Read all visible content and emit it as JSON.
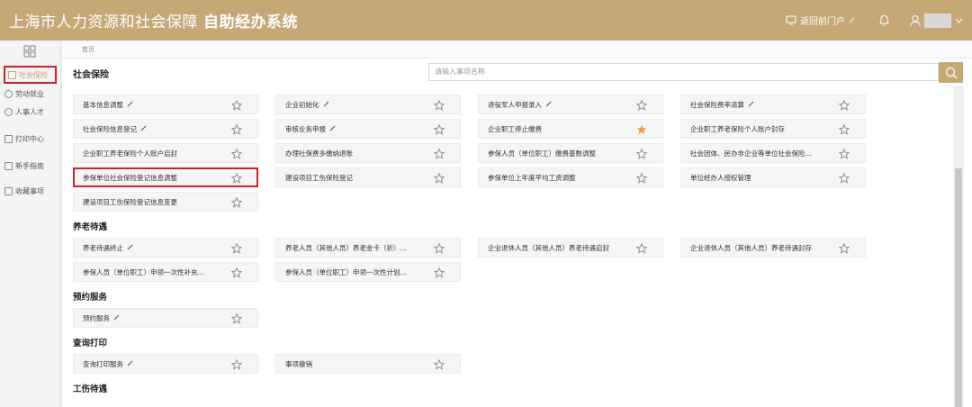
{
  "app": {
    "title": "上海市人力资源和社会保障",
    "subtitle": "自助经办系统"
  },
  "topbar": {
    "portal_label": "返回前门户",
    "user_name": ""
  },
  "sidebar": {
    "items": [
      {
        "label": "社会保险",
        "icon": "folder-icon",
        "active": true
      },
      {
        "label": "劳动就业",
        "icon": "person-icon"
      },
      {
        "label": "人事人才",
        "icon": "people-icon"
      },
      {
        "label": "打印中心",
        "icon": "printer-icon"
      },
      {
        "label": "新手指南",
        "icon": "guide-icon"
      },
      {
        "label": "收藏事项",
        "icon": "star-icon"
      }
    ]
  },
  "breadcrumb": "首页",
  "page_title": "社会保险",
  "search": {
    "placeholder": "请输入事项名称"
  },
  "sections": [
    {
      "title": "",
      "rows": [
        [
          {
            "label": "基本信息调整",
            "edit": true
          },
          {
            "label": "企业初始化",
            "edit": true
          },
          {
            "label": "退役军人申报录入",
            "edit": true
          },
          {
            "label": "社会保险费率清算",
            "edit": true
          }
        ],
        [
          {
            "label": "社会保险信息登记",
            "edit": true
          },
          {
            "label": "审核业务申报",
            "edit": true
          },
          {
            "label": "企业职工停止缴费",
            "fav": true
          },
          {
            "label": "企业职工养老保险个人账户封存"
          }
        ],
        [
          {
            "label": "企业职工养老保险个人账户启封"
          },
          {
            "label": "办理社保费多缴纳退账"
          },
          {
            "label": "参保人员（单位职工）缴费基数调整"
          },
          {
            "label": "社会团体、民办非企业等单位社会保险..."
          }
        ],
        [
          {
            "label": "参保单位社会保险登记信息调整",
            "boxed": true
          },
          {
            "label": "建设项目工伤保险登记"
          },
          {
            "label": "参保单位上年度平均工资调整"
          },
          {
            "label": "单位经办人授权管理"
          }
        ],
        [
          {
            "label": "建设项目工伤保险登记信息变更"
          }
        ]
      ]
    },
    {
      "title": "养老待遇",
      "rows": [
        [
          {
            "label": "养老待遇终止",
            "edit": true
          },
          {
            "label": "养老人员（其他人员）养老金卡（折）..."
          },
          {
            "label": "企业退休人员（其他人员）养老待遇启封"
          },
          {
            "label": "企业退休人员（其他人员）养老待遇封存"
          }
        ],
        [
          {
            "label": "参保人员（单位职工）申领一次性补充..."
          },
          {
            "label": "参保人员（单位职工）申领一次性计划..."
          }
        ]
      ]
    },
    {
      "title": "预约服务",
      "rows": [
        [
          {
            "label": "预约服务",
            "edit": true
          }
        ]
      ]
    },
    {
      "title": "查询打印",
      "rows": [
        [
          {
            "label": "查询打印服务",
            "edit": true
          },
          {
            "label": "事项撤销"
          }
        ]
      ]
    },
    {
      "title": "工伤待遇",
      "rows": []
    }
  ],
  "colors": {
    "brand": "#c6a877",
    "highlight": "#d0202a",
    "favorite": "#e6a23c"
  }
}
